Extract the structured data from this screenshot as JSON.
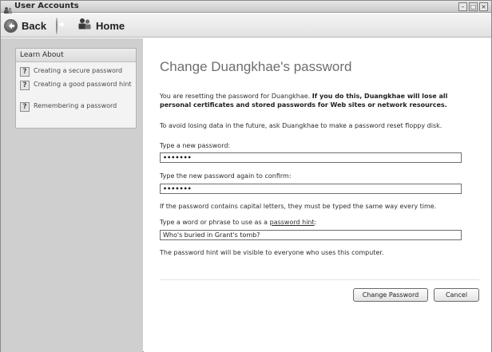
{
  "window": {
    "title": "User Accounts",
    "controls": {
      "minimize": "–",
      "maximize": "□",
      "close": "×"
    }
  },
  "toolbar": {
    "back_label": "Back",
    "home_label": "Home"
  },
  "sidebar": {
    "header": "Learn About",
    "items": [
      {
        "label": "Creating a secure password",
        "icon": "help-icon"
      },
      {
        "label": "Creating a good password hint",
        "icon": "help-icon"
      },
      {
        "label": "Remembering a password",
        "icon": "help-icon"
      }
    ]
  },
  "main": {
    "heading": "Change Duangkhae's password",
    "warning_plain": "You are resetting the password for Duangkhae.",
    "warning_bold": "If you do this, Duangkhae will lose all personal certificates and stored passwords for Web sites or network resources.",
    "floppy_note": "To avoid losing data in the future, ask Duangkhae to make a password reset floppy disk.",
    "new_password_label": "Type a new password:",
    "new_password_value": "•••••••",
    "confirm_password_label": "Type the new password again to confirm:",
    "confirm_password_value": "•••••••",
    "caps_note": "If the password contains capital letters, they must be typed the same way every time.",
    "hint_label_prefix": "Type a word or phrase to use as a",
    "hint_link": "password hint",
    "hint_label_suffix": ":",
    "hint_value": "Who's buried in Grant's tomb?",
    "hint_visibility_note": "The password hint will be visible to everyone who uses this computer.",
    "change_button": "Change Password",
    "cancel_button": "Cancel"
  },
  "colors": {
    "sidebar_bg": "#cfcfcf",
    "heading": "#6e6e6e"
  }
}
